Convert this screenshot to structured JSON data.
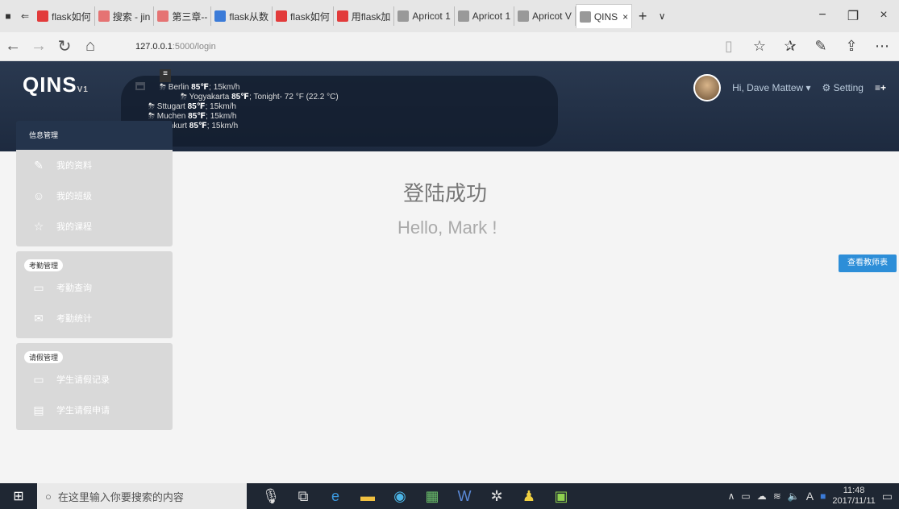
{
  "browser": {
    "tabs": [
      {
        "label": "flask如何",
        "color": "#e23b3b"
      },
      {
        "label": "搜索 - jin",
        "color": "#e57373"
      },
      {
        "label": "第三章--",
        "color": "#e57373"
      },
      {
        "label": "flask从数",
        "color": "#3b7bd8"
      },
      {
        "label": "flask如何",
        "color": "#e23b3b"
      },
      {
        "label": "用flask加",
        "color": "#e23b3b"
      },
      {
        "label": "Apricot 1",
        "color": "#999999"
      },
      {
        "label": "Apricot 1",
        "color": "#999999"
      },
      {
        "label": "Apricot V",
        "color": "#999999"
      },
      {
        "label": "QINS",
        "color": "#999999"
      }
    ],
    "url_host": "127.0.0.1",
    "url_path": ":5000/login"
  },
  "header": {
    "logo": "QINS",
    "logo_version": "V1",
    "user_greeting": "Hi, Dave Mattew ▾",
    "setting_label": "Setting"
  },
  "weather": [
    {
      "city": "Berlin",
      "temp": "85℉",
      "detail": "; 15km/h"
    },
    {
      "city": "Yogyakarta",
      "temp": "85℉",
      "detail": "; Tonight- 72 °F (22.2 °C)"
    },
    {
      "city": "Sttugart",
      "temp": "85℉",
      "detail": "; 15km/h"
    },
    {
      "city": "Muchen",
      "temp": "85℉",
      "detail": "; 15km/h"
    },
    {
      "city": "Frankurt",
      "temp": "85℉",
      "detail": "; 15km/h"
    }
  ],
  "sidebar": {
    "groups": [
      {
        "title": "信息管理",
        "items": [
          {
            "label": "我的资料",
            "icon": "edit-icon"
          },
          {
            "label": "我的班级",
            "icon": "users-icon"
          },
          {
            "label": "我的课程",
            "icon": "star-icon"
          }
        ]
      },
      {
        "title": "考勤管理",
        "items": [
          {
            "label": "考勤查询",
            "icon": "calendar-icon"
          },
          {
            "label": "考勤统计",
            "icon": "mail-icon"
          }
        ]
      },
      {
        "title": "请假管理",
        "items": [
          {
            "label": "学生请假记录",
            "icon": "monitor-icon"
          },
          {
            "label": "学生请假申请",
            "icon": "doc-icon"
          }
        ]
      }
    ]
  },
  "main": {
    "title": "登陆成功",
    "subtitle": "Hello, Mark !",
    "teacher_button": "查看教师表"
  },
  "taskbar": {
    "search_placeholder": "在这里输入你要搜索的内容",
    "time": "11:48",
    "date": "2017/11/11"
  }
}
